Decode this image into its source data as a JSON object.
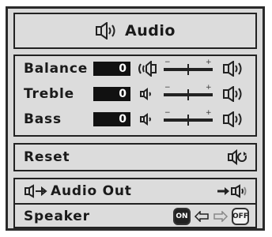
{
  "header": {
    "title": "Audio",
    "icon": "speaker-icon"
  },
  "audio_settings": [
    {
      "label": "Balance",
      "value": "0",
      "left_icon": "balance-left-speaker-icon",
      "right_icon": "balance-right-speaker-icon"
    },
    {
      "label": "Treble",
      "value": "0",
      "left_icon": "speaker-low-icon",
      "right_icon": "speaker-high-icon"
    },
    {
      "label": "Bass",
      "value": "0",
      "left_icon": "speaker-low-icon",
      "right_icon": "speaker-high-icon"
    }
  ],
  "reset": {
    "label": "Reset",
    "icon": "reset-icon"
  },
  "audio_out": {
    "label": "Audio Out",
    "icon": "audio-out-icon",
    "target_icon": "arrow-speaker-icon"
  },
  "speaker": {
    "label": "Speaker",
    "on_label": "ON",
    "off_label": "OFF",
    "icon": "on-off-toggle-icon"
  }
}
